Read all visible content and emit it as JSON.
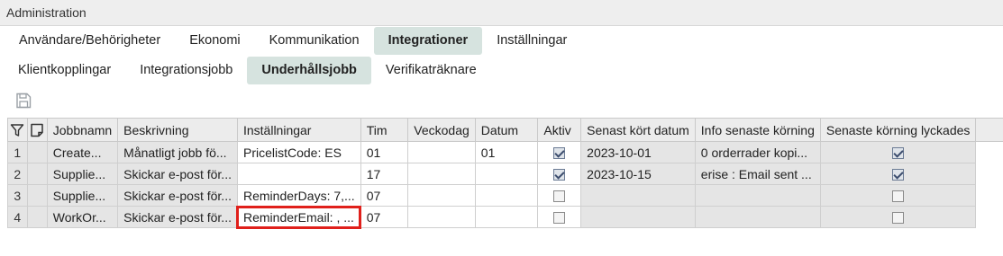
{
  "window": {
    "title": "Administration"
  },
  "tabs_primary": [
    {
      "label": "Användare/Behörigheter",
      "active": false
    },
    {
      "label": "Ekonomi",
      "active": false
    },
    {
      "label": "Kommunikation",
      "active": false
    },
    {
      "label": "Integrationer",
      "active": true
    },
    {
      "label": "Inställningar",
      "active": false
    }
  ],
  "tabs_secondary": [
    {
      "label": "Klientkopplingar",
      "active": false
    },
    {
      "label": "Integrationsjobb",
      "active": false
    },
    {
      "label": "Underhållsjobb",
      "active": true
    },
    {
      "label": "Verifikaträknare",
      "active": false
    }
  ],
  "toolbar": {
    "save_icon": "save-icon"
  },
  "grid": {
    "header_icons": {
      "filter": "filter-icon",
      "note": "note-icon"
    },
    "columns": [
      "Jobbnamn",
      "Beskrivning",
      "Inställningar",
      "Tim",
      "Veckodag",
      "Datum",
      "Aktiv",
      "Senast kört datum",
      "Info senaste körning",
      "Senaste körning lyckades"
    ],
    "rows": [
      {
        "num": "1",
        "name": "Create...",
        "desc": "Månatligt jobb fö...",
        "settings": "PricelistCode: ES",
        "tim": "01",
        "veckodag": "",
        "datum": "01",
        "aktiv": true,
        "last_run": "2023-10-01",
        "info": "0 orderrader kopi...",
        "success": true
      },
      {
        "num": "2",
        "name": "Supplie...",
        "desc": "Skickar e-post för...",
        "settings": "",
        "tim": "17",
        "veckodag": "",
        "datum": "",
        "aktiv": true,
        "last_run": "2023-10-15",
        "info": "erise : Email sent ...",
        "success": true
      },
      {
        "num": "3",
        "name": "Supplie...",
        "desc": "Skickar e-post för...",
        "settings": "ReminderDays: 7,...",
        "tim": "07",
        "veckodag": "",
        "datum": "",
        "aktiv": false,
        "last_run": "",
        "info": "",
        "success": false
      },
      {
        "num": "4",
        "name": "WorkOr...",
        "desc": "Skickar e-post för...",
        "settings": "ReminderEmail: , ...",
        "tim": "07",
        "veckodag": "",
        "datum": "",
        "aktiv": false,
        "last_run": "",
        "info": "",
        "success": false
      }
    ],
    "highlighted_cell": {
      "row": 4,
      "column": "Inställningar",
      "color": "#e0201b"
    }
  },
  "colors": {
    "active_tab": "#d6e3df",
    "header_bg": "#ececec",
    "readonly_cell": "#e5e5e5",
    "highlight": "#e0201b"
  }
}
